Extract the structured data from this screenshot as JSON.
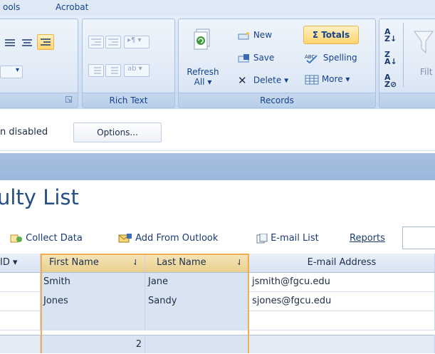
{
  "menu": {
    "tools": "ools",
    "acrobat": "Acrobat"
  },
  "ribbon": {
    "rich_text_label": "Rich Text",
    "records_label": "Records",
    "records": {
      "refresh": "Refresh",
      "refresh_sub": "All ▾",
      "new": "New",
      "save": "Save",
      "delete": "Delete ▾",
      "totals": "Totals",
      "spelling": "Spelling",
      "more": "More ▾"
    },
    "filter_partial": "Filt"
  },
  "message_bar": {
    "text": "n disabled",
    "options_button": "Options..."
  },
  "form": {
    "title": "ulty List"
  },
  "toolbar": {
    "collect_data": "Collect Data",
    "add_from_outlook": "Add From Outlook",
    "email_list": "E-mail List",
    "reports": "Reports"
  },
  "table": {
    "columns": [
      "ID ▾",
      "First Name",
      "Last Name",
      "E-mail Address"
    ],
    "rows": [
      [
        "Smith",
        "Jane",
        "jsmith@fgcu.edu"
      ],
      [
        "Jones",
        "Sandy",
        "sjones@fgcu.edu"
      ]
    ],
    "total_count": "2"
  },
  "colors": {
    "accent": "#f1ad53",
    "ribbon_text": "#15428b",
    "title": "#244e85"
  }
}
